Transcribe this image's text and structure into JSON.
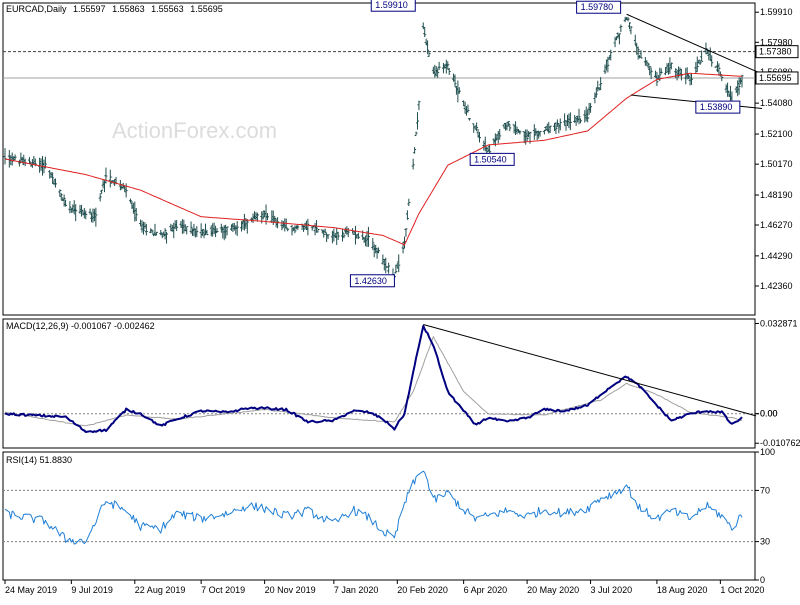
{
  "colors": {
    "price_bars": "#1f4e4e",
    "moving_average": "#e02020",
    "macd_line": "#000080",
    "signal_line": "#a0a0a0",
    "rsi_line": "#1e7fd6",
    "label_border": "#000080",
    "label_text": "#000080",
    "grid": "#808080",
    "watermark": "#dcdcdc"
  },
  "header": {
    "symbol": "EURCAD,Daily",
    "open": "1.55597",
    "high": "1.55863",
    "low": "1.55563",
    "close": "1.55695"
  },
  "watermark": "ActionForex.com",
  "chart_data": [
    {
      "type": "line",
      "name": "price-panel",
      "title": "EURCAD,Daily",
      "ylim": [
        1.405,
        1.605
      ],
      "y_ticks": [
        "1.59910",
        "1.57980",
        "1.56080",
        "1.54080",
        "1.52100",
        "1.50170",
        "1.48190",
        "1.46270",
        "1.44290",
        "1.42360"
      ],
      "y_tick_values": [
        1.5991,
        1.5798,
        1.5608,
        1.5408,
        1.521,
        1.5017,
        1.4819,
        1.4627,
        1.4429,
        1.4236
      ],
      "current_price": "1.55695",
      "resistance_level": "1.57380",
      "annotations": [
        {
          "text": "1.59910",
          "date": "2020-03-09",
          "value": 1.5991
        },
        {
          "text": "1.59780",
          "date": "2020-07-28",
          "value": 1.5978
        },
        {
          "text": "1.57380",
          "value": 1.5738
        },
        {
          "text": "1.53890",
          "date": "2020-09-14",
          "value": 1.5389
        },
        {
          "text": "1.50540",
          "date": "2020-04-23",
          "value": 1.5054
        },
        {
          "text": "1.42630",
          "date": "2020-02-18",
          "value": 1.4263
        }
      ],
      "price_anchors": [
        [
          "2019-05-24",
          1.506
        ],
        [
          "2019-06-07",
          1.503
        ],
        [
          "2019-06-21",
          1.501
        ],
        [
          "2019-07-05",
          1.476
        ],
        [
          "2019-07-19",
          1.47
        ],
        [
          "2019-07-26",
          1.468
        ],
        [
          "2019-08-02",
          1.495
        ],
        [
          "2019-08-16",
          1.484
        ],
        [
          "2019-08-26",
          1.462
        ],
        [
          "2019-09-09",
          1.456
        ],
        [
          "2019-09-20",
          1.462
        ],
        [
          "2019-10-07",
          1.458
        ],
        [
          "2019-10-25",
          1.46
        ],
        [
          "2019-11-08",
          1.464
        ],
        [
          "2019-11-20",
          1.47
        ],
        [
          "2019-12-05",
          1.46
        ],
        [
          "2019-12-20",
          1.462
        ],
        [
          "2020-01-07",
          1.456
        ],
        [
          "2020-01-20",
          1.458
        ],
        [
          "2020-02-01",
          1.453
        ],
        [
          "2020-02-10",
          1.44
        ],
        [
          "2020-02-18",
          1.429
        ],
        [
          "2020-02-25",
          1.452
        ],
        [
          "2020-03-02",
          1.5
        ],
        [
          "2020-03-06",
          1.54
        ],
        [
          "2020-03-09",
          1.589
        ],
        [
          "2020-03-16",
          1.56
        ],
        [
          "2020-03-26",
          1.565
        ],
        [
          "2020-04-06",
          1.54
        ],
        [
          "2020-04-14",
          1.525
        ],
        [
          "2020-04-23",
          1.51
        ],
        [
          "2020-05-06",
          1.528
        ],
        [
          "2020-05-20",
          1.52
        ],
        [
          "2020-06-01",
          1.523
        ],
        [
          "2020-06-15",
          1.528
        ],
        [
          "2020-07-01",
          1.533
        ],
        [
          "2020-07-10",
          1.554
        ],
        [
          "2020-07-20",
          1.58
        ],
        [
          "2020-07-28",
          1.596
        ],
        [
          "2020-08-06",
          1.572
        ],
        [
          "2020-08-18",
          1.556
        ],
        [
          "2020-08-28",
          1.565
        ],
        [
          "2020-09-10",
          1.556
        ],
        [
          "2020-09-21",
          1.574
        ],
        [
          "2020-10-02",
          1.559
        ],
        [
          "2020-10-09",
          1.542
        ],
        [
          "2020-10-16",
          1.557
        ]
      ],
      "ma_anchors": [
        [
          "2019-05-24",
          1.505
        ],
        [
          "2019-07-19",
          1.495
        ],
        [
          "2019-08-26",
          1.485
        ],
        [
          "2019-10-07",
          1.468
        ],
        [
          "2019-11-20",
          1.465
        ],
        [
          "2020-01-07",
          1.461
        ],
        [
          "2020-02-10",
          1.456
        ],
        [
          "2020-02-25",
          1.45
        ],
        [
          "2020-03-06",
          1.47
        ],
        [
          "2020-03-26",
          1.501
        ],
        [
          "2020-04-23",
          1.514
        ],
        [
          "2020-06-01",
          1.517
        ],
        [
          "2020-07-01",
          1.523
        ],
        [
          "2020-07-28",
          1.544
        ],
        [
          "2020-08-18",
          1.556
        ],
        [
          "2020-09-10",
          1.56
        ],
        [
          "2020-10-16",
          1.558
        ]
      ],
      "trendlines": [
        {
          "name": "upper",
          "from": [
            "2020-07-28",
            1.5978
          ],
          "to": [
            "2020-10-16",
            1.562
          ]
        },
        {
          "name": "lower",
          "from": [
            "2020-07-31",
            1.546
          ],
          "to": [
            "2020-10-16",
            1.538
          ]
        }
      ]
    },
    {
      "type": "line",
      "name": "macd-panel",
      "title": "MACD(12,26,9) -0.001067 -0.002462",
      "ylim": [
        -0.0125,
        0.0345
      ],
      "y_ticks": [
        "0.032871",
        "0.00",
        "0.00",
        "-0.010762"
      ],
      "y_tick_values": [
        0.032871,
        0.0,
        0.0,
        -0.010762
      ],
      "series": [
        {
          "name": "MACD",
          "anchors": [
            [
              "2019-05-24",
              0.0
            ],
            [
              "2019-07-05",
              -0.0012
            ],
            [
              "2019-07-19",
              -0.0065
            ],
            [
              "2019-08-02",
              -0.006
            ],
            [
              "2019-08-16",
              0.0015
            ],
            [
              "2019-08-26",
              0.0
            ],
            [
              "2019-09-09",
              -0.0045
            ],
            [
              "2019-09-20",
              -0.002
            ],
            [
              "2019-10-07",
              0.001
            ],
            [
              "2019-10-25",
              0.0005
            ],
            [
              "2019-11-08",
              0.002
            ],
            [
              "2019-11-20",
              0.002
            ],
            [
              "2019-12-05",
              0.0015
            ],
            [
              "2019-12-20",
              -0.003
            ],
            [
              "2020-01-07",
              -0.0025
            ],
            [
              "2020-01-20",
              0.001
            ],
            [
              "2020-02-01",
              0.0005
            ],
            [
              "2020-02-10",
              -0.002
            ],
            [
              "2020-02-18",
              -0.0055
            ],
            [
              "2020-02-25",
              0.0
            ],
            [
              "2020-03-02",
              0.015
            ],
            [
              "2020-03-09",
              0.032
            ],
            [
              "2020-03-16",
              0.025
            ],
            [
              "2020-03-26",
              0.008
            ],
            [
              "2020-04-06",
              0.001
            ],
            [
              "2020-04-14",
              -0.004
            ],
            [
              "2020-04-23",
              -0.0015
            ],
            [
              "2020-05-06",
              -0.003
            ],
            [
              "2020-05-20",
              -0.0015
            ],
            [
              "2020-06-01",
              0.0015
            ],
            [
              "2020-06-15",
              0.001
            ],
            [
              "2020-07-01",
              0.003
            ],
            [
              "2020-07-10",
              0.007
            ],
            [
              "2020-07-20",
              0.011
            ],
            [
              "2020-07-28",
              0.0135
            ],
            [
              "2020-08-06",
              0.01
            ],
            [
              "2020-08-18",
              0.003
            ],
            [
              "2020-08-28",
              -0.0025
            ],
            [
              "2020-09-10",
              0.0
            ],
            [
              "2020-09-21",
              0.001
            ],
            [
              "2020-10-02",
              0.0005
            ],
            [
              "2020-10-09",
              -0.004
            ],
            [
              "2020-10-16",
              -0.0015
            ]
          ]
        },
        {
          "name": "Signal",
          "anchors": [
            [
              "2019-05-24",
              0.0005
            ],
            [
              "2019-07-19",
              -0.0045
            ],
            [
              "2019-08-16",
              -0.0005
            ],
            [
              "2019-09-20",
              -0.002
            ],
            [
              "2019-11-20",
              0.0015
            ],
            [
              "2020-01-07",
              -0.0015
            ],
            [
              "2020-02-18",
              -0.003
            ],
            [
              "2020-03-02",
              0.008
            ],
            [
              "2020-03-16",
              0.028
            ],
            [
              "2020-04-06",
              0.008
            ],
            [
              "2020-04-23",
              0.0
            ],
            [
              "2020-06-01",
              -0.0005
            ],
            [
              "2020-07-10",
              0.005
            ],
            [
              "2020-07-28",
              0.011
            ],
            [
              "2020-08-18",
              0.007
            ],
            [
              "2020-09-10",
              0.0005
            ],
            [
              "2020-10-09",
              -0.0015
            ],
            [
              "2020-10-16",
              -0.0025
            ]
          ]
        }
      ],
      "trendlines": [
        {
          "name": "macd-trend",
          "from": [
            "2020-03-09",
            0.0325
          ],
          "to": [
            "2020-10-16",
            -0.0005
          ]
        }
      ]
    },
    {
      "type": "line",
      "name": "rsi-panel",
      "title": "RSI(14) 51.8830",
      "ylim": [
        0,
        100
      ],
      "y_ticks": [
        "100",
        "70",
        "30",
        "0"
      ],
      "y_tick_values": [
        100,
        70,
        30,
        0
      ],
      "levels": [
        70,
        30
      ],
      "series": [
        {
          "name": "RSI",
          "anchors": [
            [
              "2019-05-24",
              52
            ],
            [
              "2019-06-21",
              46
            ],
            [
              "2019-07-05",
              32
            ],
            [
              "2019-07-19",
              30
            ],
            [
              "2019-08-02",
              62
            ],
            [
              "2019-08-16",
              54
            ],
            [
              "2019-08-26",
              42
            ],
            [
              "2019-09-09",
              40
            ],
            [
              "2019-09-20",
              52
            ],
            [
              "2019-10-07",
              48
            ],
            [
              "2019-10-25",
              52
            ],
            [
              "2019-11-08",
              58
            ],
            [
              "2019-11-20",
              56
            ],
            [
              "2019-12-05",
              50
            ],
            [
              "2019-12-20",
              54
            ],
            [
              "2020-01-07",
              44
            ],
            [
              "2020-01-20",
              55
            ],
            [
              "2020-02-01",
              48
            ],
            [
              "2020-02-10",
              38
            ],
            [
              "2020-02-18",
              32
            ],
            [
              "2020-02-25",
              60
            ],
            [
              "2020-03-02",
              75
            ],
            [
              "2020-03-09",
              88
            ],
            [
              "2020-03-16",
              62
            ],
            [
              "2020-03-26",
              68
            ],
            [
              "2020-04-06",
              55
            ],
            [
              "2020-04-14",
              48
            ],
            [
              "2020-04-23",
              50
            ],
            [
              "2020-05-06",
              54
            ],
            [
              "2020-05-20",
              50
            ],
            [
              "2020-06-01",
              55
            ],
            [
              "2020-06-15",
              52
            ],
            [
              "2020-07-01",
              56
            ],
            [
              "2020-07-10",
              64
            ],
            [
              "2020-07-20",
              68
            ],
            [
              "2020-07-28",
              74
            ],
            [
              "2020-08-06",
              56
            ],
            [
              "2020-08-18",
              48
            ],
            [
              "2020-08-28",
              54
            ],
            [
              "2020-09-10",
              48
            ],
            [
              "2020-09-21",
              58
            ],
            [
              "2020-10-02",
              50
            ],
            [
              "2020-10-09",
              40
            ],
            [
              "2020-10-16",
              52
            ]
          ]
        }
      ]
    },
    {
      "type": "axis",
      "name": "time-axis",
      "x_ticks": [
        "24 May 2019",
        "9 Jul 2019",
        "22 Aug 2019",
        "7 Oct 2019",
        "20 Nov 2019",
        "7 Jan 2020",
        "20 Feb 2020",
        "6 Apr 2020",
        "20 May 2020",
        "3 Jul 2020",
        "18 Aug 2020",
        "1 Oct 2020"
      ],
      "x_tick_dates": [
        "2019-05-24",
        "2019-07-09",
        "2019-08-22",
        "2019-10-07",
        "2019-11-20",
        "2020-01-07",
        "2020-02-20",
        "2020-04-06",
        "2020-05-20",
        "2020-07-03",
        "2020-08-18",
        "2020-10-01"
      ]
    }
  ]
}
